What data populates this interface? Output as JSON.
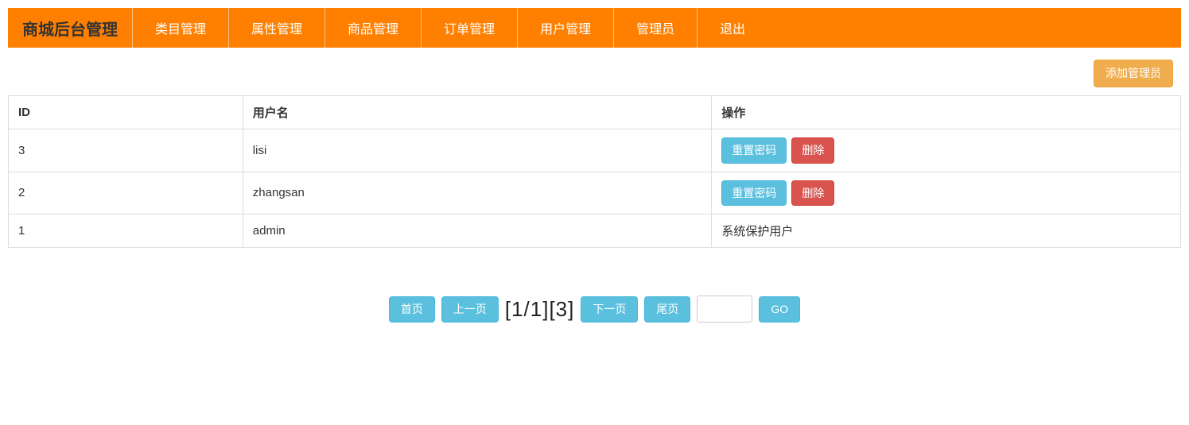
{
  "nav": {
    "brand": "商城后台管理",
    "items": [
      "类目管理",
      "属性管理",
      "商品管理",
      "订单管理",
      "用户管理",
      "管理员",
      "退出"
    ]
  },
  "toolbar": {
    "add_admin": "添加管理员"
  },
  "table": {
    "headers": {
      "id": "ID",
      "username": "用户名",
      "action": "操作"
    },
    "rows": [
      {
        "id": "3",
        "username": "lisi",
        "protected": false
      },
      {
        "id": "2",
        "username": "zhangsan",
        "protected": false
      },
      {
        "id": "1",
        "username": "admin",
        "protected": true
      }
    ],
    "action_labels": {
      "reset_password": "重置密码",
      "delete": "删除",
      "protected_text": "系统保护用户"
    }
  },
  "pagination": {
    "first": "首页",
    "prev": "上一页",
    "info": "[1/1][3]",
    "next": "下一页",
    "last": "尾页",
    "go": "GO"
  }
}
